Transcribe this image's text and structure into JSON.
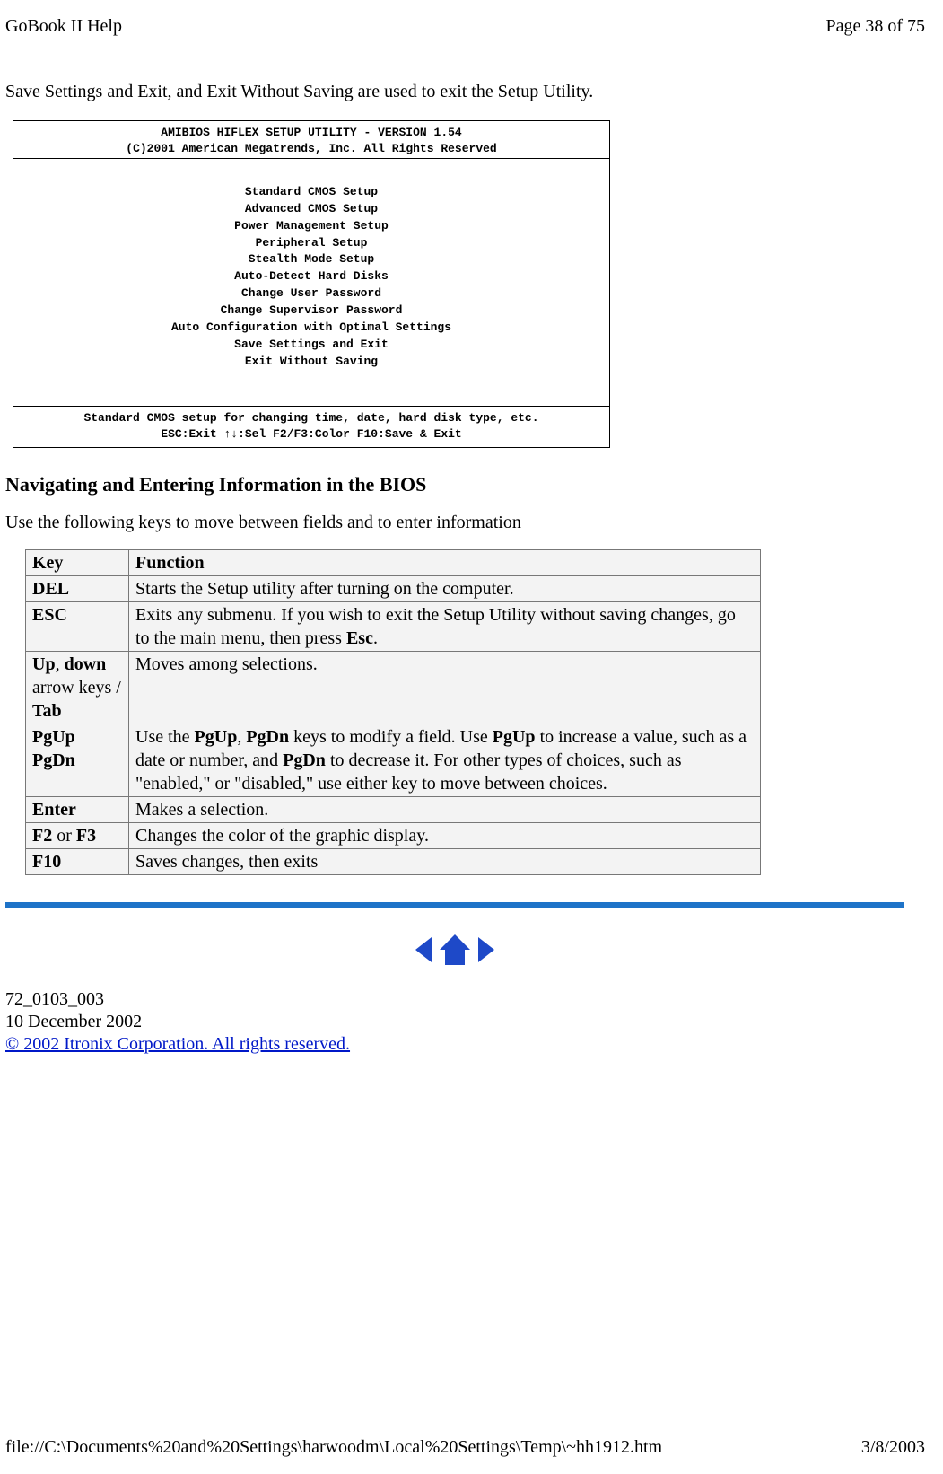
{
  "header": {
    "left": "GoBook II Help",
    "right": "Page 38 of 75"
  },
  "intro": "Save Settings and Exit, and Exit Without Saving are used to exit the Setup Utility.",
  "bios": {
    "title_line1": "AMIBIOS HIFLEX SETUP UTILITY - VERSION 1.54",
    "title_line2": "(C)2001 American Megatrends, Inc. All Rights Reserved",
    "menu_items": [
      "Standard CMOS Setup",
      "Advanced CMOS Setup",
      "Power Management Setup",
      "Peripheral Setup",
      "Stealth Mode Setup",
      "Auto-Detect Hard Disks",
      "Change User Password",
      "Change Supervisor Password",
      "Auto Configuration with Optimal Settings",
      "Save Settings and Exit",
      "Exit Without Saving"
    ],
    "status_line1": "Standard CMOS setup for changing time, date, hard disk type, etc.",
    "status_line2": "ESC:Exit  ↑↓:Sel  F2/F3:Color  F10:Save & Exit"
  },
  "section": {
    "heading": "Navigating and Entering Information in the BIOS",
    "intro": "Use the following keys to move between fields and to enter information"
  },
  "table": {
    "head_key": "Key",
    "head_func": "Function",
    "rows": [
      {
        "key_html": "<b>DEL</b>",
        "func_html": "Starts the Setup utility after turning on the computer."
      },
      {
        "key_html": "<b>ESC</b>",
        "func_html": "Exits any submenu.  If you wish to exit the Setup Utility without saving changes, go to the main menu, then press <b>Esc</b>."
      },
      {
        "key_html": "<b>Up</b>, <b>down</b> arrow keys / <b>Tab</b>",
        "func_html": "Moves among selections."
      },
      {
        "key_html": "<b>PgUp</b> <b>PgDn</b>",
        "func_html": "Use the <b>PgUp</b>, <b>PgDn</b> keys to modify a field.  Use <b>PgUp</b> to increase a value, such as a date or number, and <b>PgDn</b> to decrease it.  For other types of choices, such as &quot;enabled,&quot; or &quot;disabled,&quot; use either key to move between choices."
      },
      {
        "key_html": "<b>Enter</b>",
        "func_html": "Makes a selection."
      },
      {
        "key_html": "<b>F2</b> or <b>F3</b>",
        "func_html": "Changes the color of the graphic display."
      },
      {
        "key_html": "<b>F10</b>",
        "func_html": "Saves changes, then exits"
      }
    ]
  },
  "footer": {
    "doc_id": "72_0103_003",
    "date": "10 December 2002",
    "copyright": "© 2002 Itronix Corporation.  All rights reserved."
  },
  "bottom": {
    "path": "file://C:\\Documents%20and%20Settings\\harwoodm\\Local%20Settings\\Temp\\~hh1912.htm",
    "date": "3/8/2003"
  }
}
